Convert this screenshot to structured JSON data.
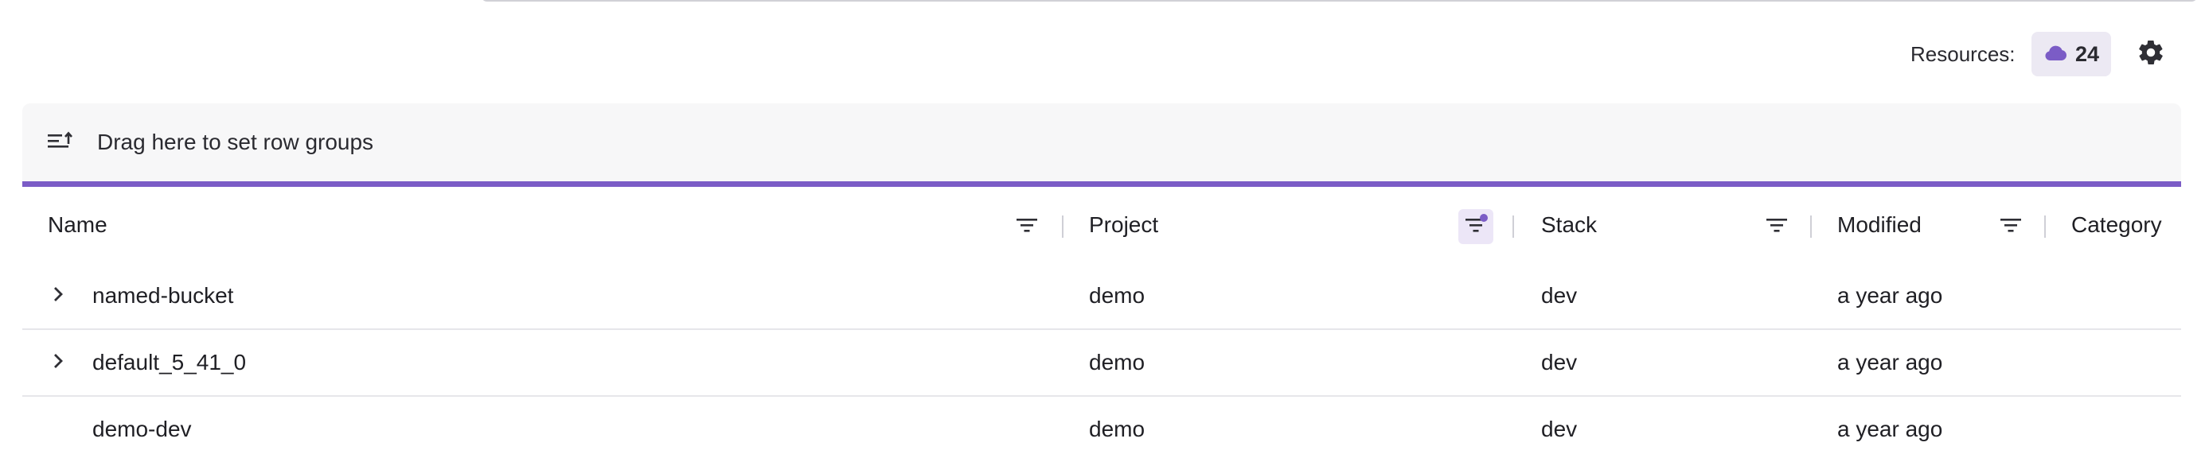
{
  "resources": {
    "label": "Resources:",
    "count": "24",
    "icon": "cloud-icon"
  },
  "grid": {
    "group_panel_text": "Drag here to set row groups",
    "columns": [
      {
        "key": "name",
        "label": "Name",
        "filter_active": false
      },
      {
        "key": "project",
        "label": "Project",
        "filter_active": true
      },
      {
        "key": "stack",
        "label": "Stack",
        "filter_active": false
      },
      {
        "key": "modified",
        "label": "Modified",
        "filter_active": false
      },
      {
        "key": "category",
        "label": "Category",
        "filter_active": false
      }
    ],
    "rows": [
      {
        "name": "named-bucket",
        "project": "demo",
        "stack": "dev",
        "modified": "a year ago",
        "expandable": true
      },
      {
        "name": "default_5_41_0",
        "project": "demo",
        "stack": "dev",
        "modified": "a year ago",
        "expandable": true
      },
      {
        "name": "demo-dev",
        "project": "demo",
        "stack": "dev",
        "modified": "a year ago",
        "expandable": false
      }
    ]
  },
  "colors": {
    "accent": "#7b5cc6",
    "accent_light": "#ece6f7",
    "panel_bg": "#f7f7f8"
  }
}
